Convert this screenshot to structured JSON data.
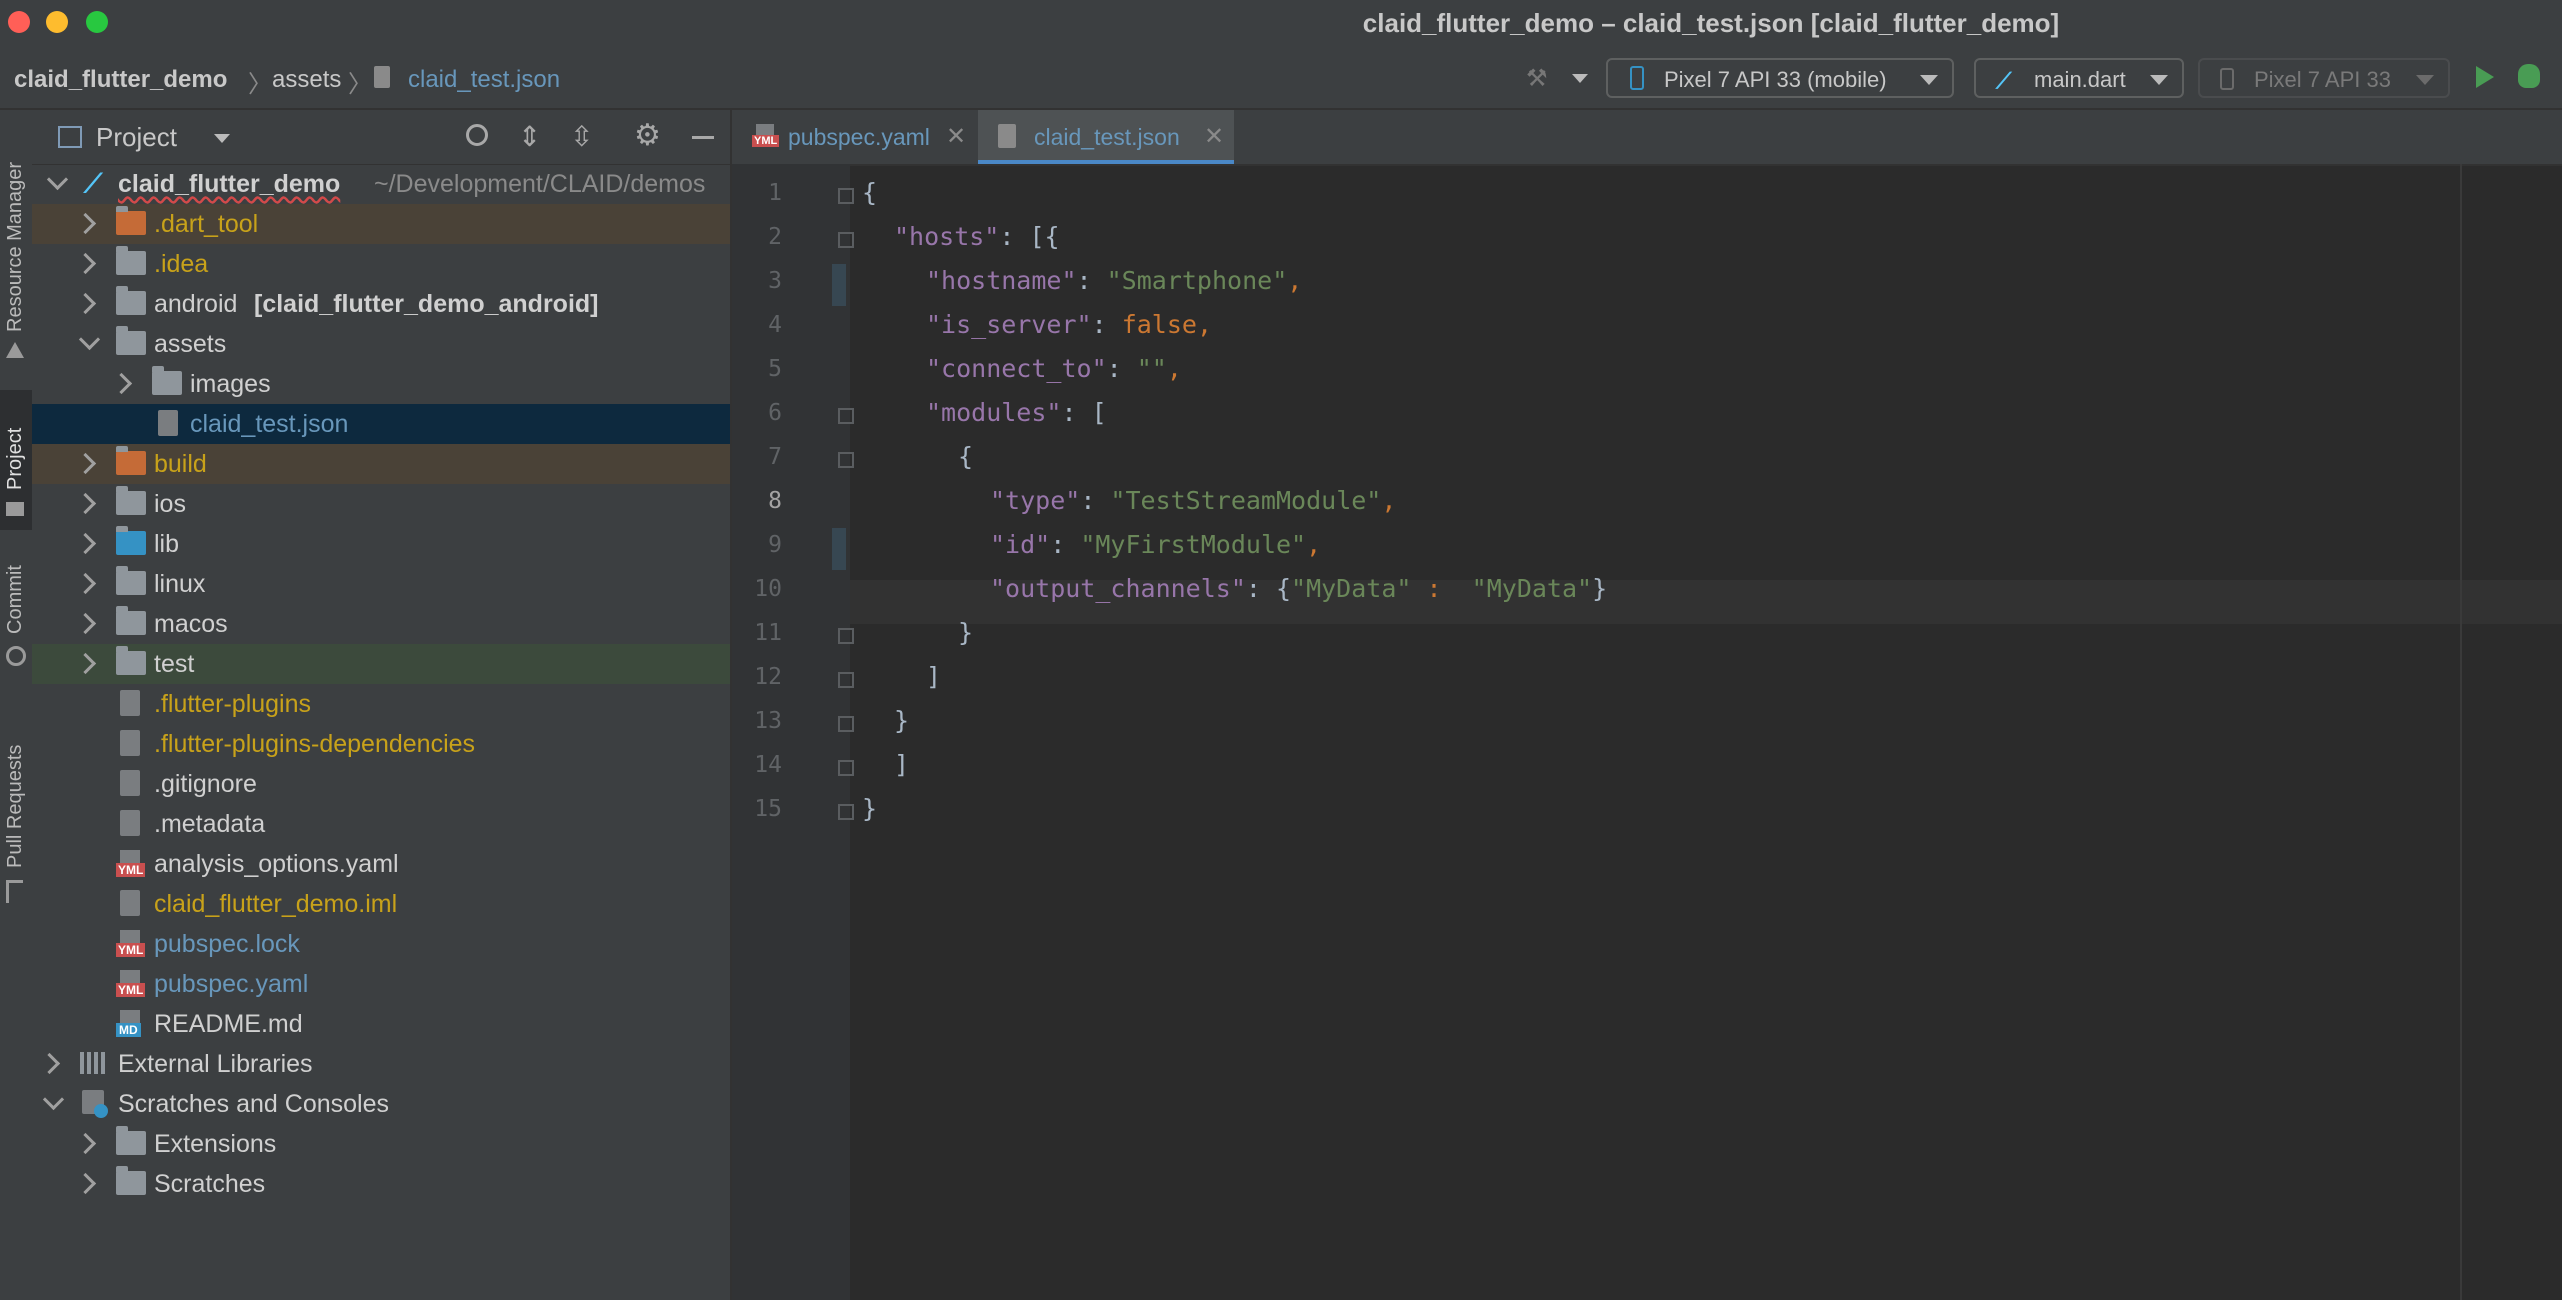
{
  "window": {
    "title": "claid_flutter_demo – claid_test.json [claid_flutter_demo]",
    "traffic_colors": [
      "#ff5f57",
      "#febc2e",
      "#28c840"
    ]
  },
  "navbar": {
    "breadcrumbs": [
      "claid_flutter_demo",
      "assets",
      "claid_test.json"
    ],
    "device_selector": "Pixel 7 API 33 (mobile)",
    "run_config": "main.dart",
    "secondary_device": "Pixel 7 API 33"
  },
  "stripe": {
    "resource_manager": "Resource Manager",
    "project": "Project",
    "commit": "Commit",
    "pull_requests": "Pull Requests"
  },
  "project_panel": {
    "title": "Project",
    "root_name": "claid_flutter_demo",
    "root_path": "~/Development/CLAID/demos",
    "android_name": "android",
    "android_module": "[claid_flutter_demo_android]",
    "items": [
      ".dart_tool",
      ".idea",
      "assets",
      "images",
      "claid_test.json",
      "build",
      "ios",
      "lib",
      "linux",
      "macos",
      "test",
      ".flutter-plugins",
      ".flutter-plugins-dependencies",
      ".gitignore",
      ".metadata",
      "analysis_options.yaml",
      "claid_flutter_demo.iml",
      "pubspec.lock",
      "pubspec.yaml",
      "README.md",
      "External Libraries",
      "Scratches and Consoles",
      "Extensions",
      "Scratches"
    ],
    "file_badges": {
      "yml": "YML",
      "md": "MD"
    }
  },
  "editor": {
    "tabs": [
      {
        "label": "pubspec.yaml",
        "badge": "YML",
        "active": false
      },
      {
        "label": "claid_test.json",
        "badge": "",
        "active": true
      }
    ],
    "close_glyph": "✕",
    "line_numbers": [
      "1",
      "2",
      "3",
      "4",
      "5",
      "6",
      "7",
      "8",
      "9",
      "10",
      "11",
      "12",
      "13",
      "14",
      "15"
    ],
    "code": {
      "l1": "{",
      "l2_key": "\"hosts\"",
      "l2_rest": ": [{",
      "l3_key": "\"hostname\"",
      "l3_colon": ": ",
      "l3_val": "\"Smartphone\"",
      "l3_comma": ",",
      "l4_key": "\"is_server\"",
      "l4_colon": ": ",
      "l4_val": "false",
      "l4_comma": ",",
      "l5_key": "\"connect_to\"",
      "l5_colon": ": ",
      "l5_val": "\"\"",
      "l5_comma": ",",
      "l6_key": "\"modules\"",
      "l6_rest": ": [",
      "l7": "{",
      "l8_key": "\"type\"",
      "l8_colon": ": ",
      "l8_val": "\"TestStreamModule\"",
      "l8_comma": ",",
      "l9_key": "\"id\"",
      "l9_colon": ": ",
      "l9_val": "\"MyFirstModule\"",
      "l9_comma": ",",
      "l10_key": "\"output_channels\"",
      "l10_colon": ": {",
      "l10_k2": "\"MyData\"",
      "l10_sep": " :  ",
      "l10_v2": "\"MyData\"",
      "l10_end": "}",
      "l11": "}",
      "l12": "]",
      "l13": "}",
      "l14": "]",
      "l15": "}"
    }
  }
}
